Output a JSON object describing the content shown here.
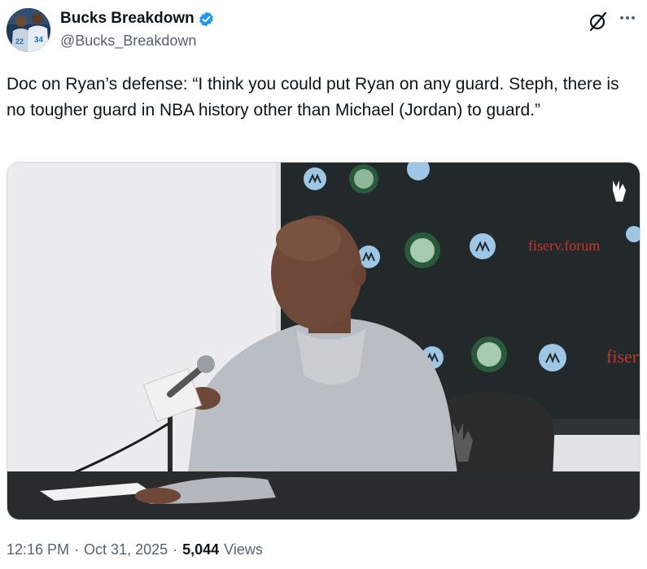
{
  "author": {
    "display_name": "Bucks Breakdown",
    "handle": "@Bucks_Breakdown",
    "verified": true,
    "avatar_jersey_numbers": [
      "22",
      "34"
    ]
  },
  "tweet": {
    "text": "Doc on Ryan’s defense: “I think you could put Ryan on any guard. Steph, there is no tougher guard in NBA history other than Michael (Jordan) to guard.”"
  },
  "media": {
    "backdrop_text": [
      "fiserv.forum",
      "fiserv"
    ]
  },
  "meta": {
    "time": "12:16 PM",
    "separator": "·",
    "date": "Oct 31, 2025",
    "views_count": "5,044",
    "views_label": "Views"
  },
  "colors": {
    "verified_blue": "#1d9bf0",
    "text_primary": "#0f1419",
    "text_secondary": "#536471",
    "bucks_green": "#00471b",
    "bucks_cream": "#eee1c6"
  },
  "icons": {
    "verified": "verified-badge-icon",
    "grok": "grok-icon",
    "more": "more-options-icon"
  }
}
